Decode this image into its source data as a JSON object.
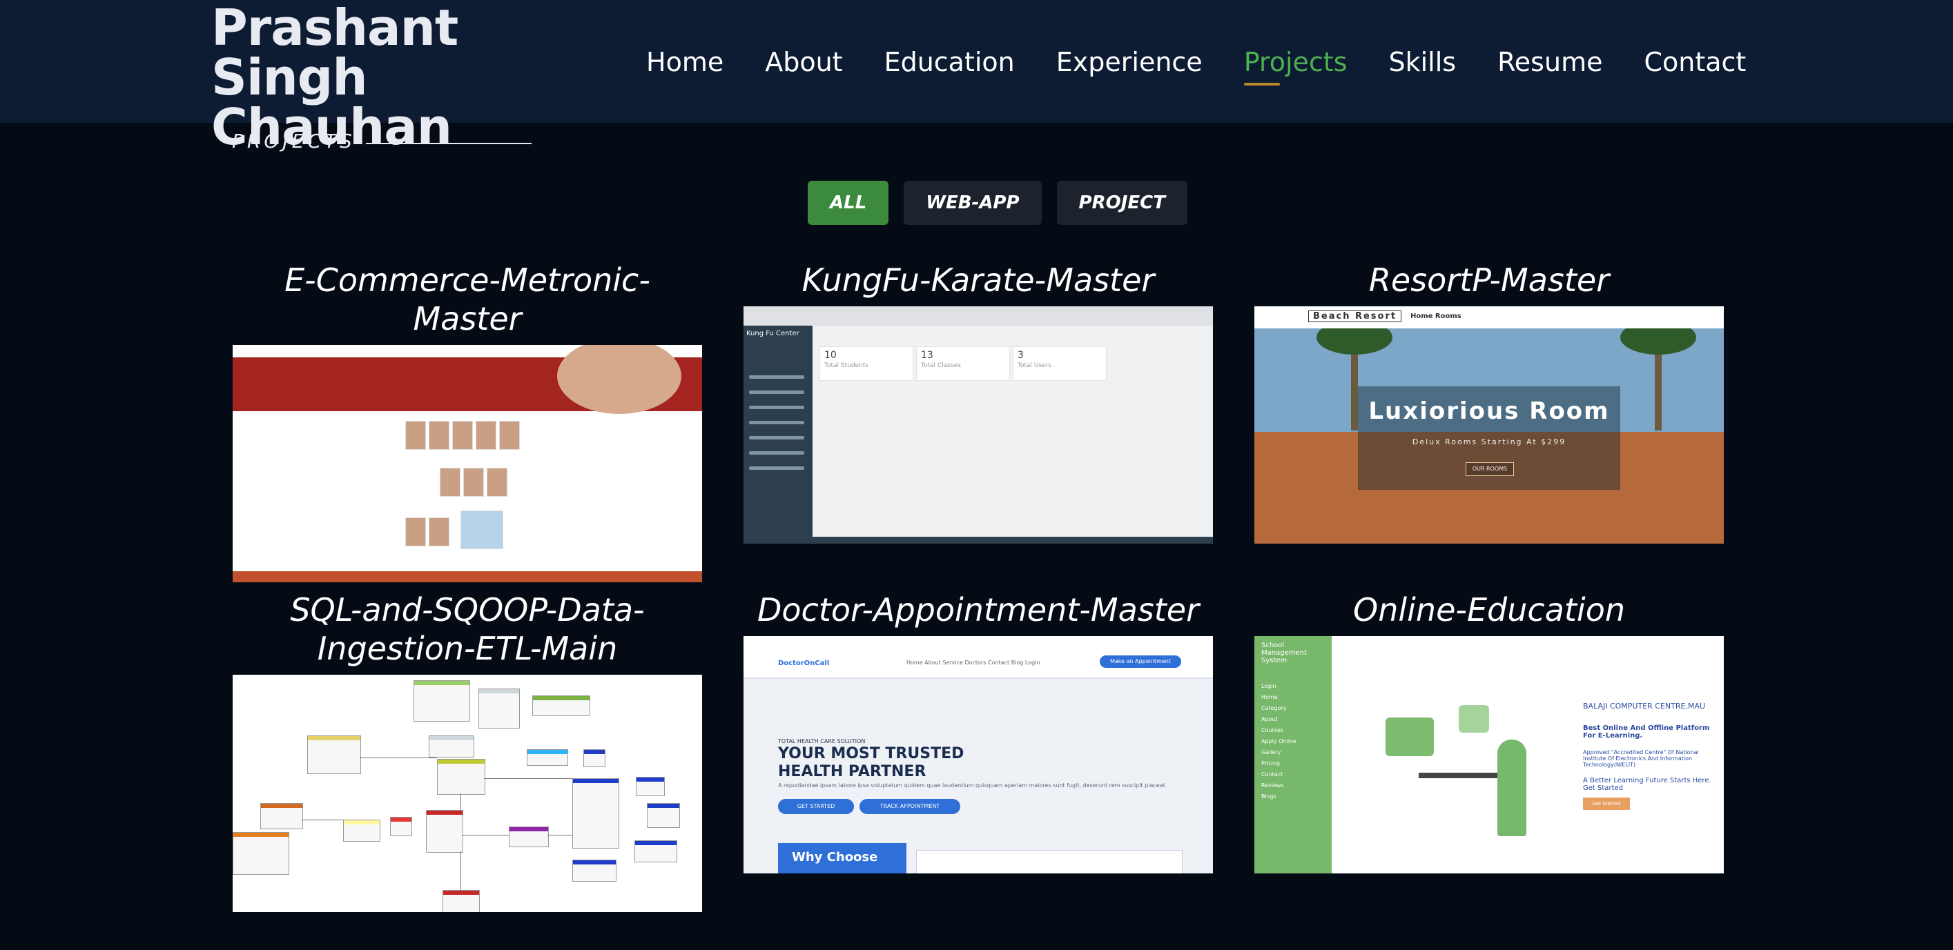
{
  "header": {
    "name_line1": "Prashant Singh",
    "name_line2": "Chauhan",
    "nav": [
      "Home",
      "About",
      "Education",
      "Experience",
      "Projects",
      "Skills",
      "Resume",
      "Contact"
    ],
    "active_nav": "Projects"
  },
  "section": {
    "title": "PROJECTS"
  },
  "filters": {
    "all": "ALL",
    "webapp": "WEB-APP",
    "project": "PROJECT",
    "active": "ALL"
  },
  "projects": [
    {
      "title": "E-Commerce-Metronic-Master"
    },
    {
      "title": "KungFu-Karate-Master"
    },
    {
      "title": "ResortP-Master"
    },
    {
      "title": "SQL-and-SQOOP-Data-Ingestion-ETL-Main"
    },
    {
      "title": "Doctor-Appointment-Master"
    },
    {
      "title": "Online-Education"
    }
  ],
  "thumbs": {
    "kungfu": {
      "app_name": "Kung Fu Center",
      "stats": [
        {
          "num": "10",
          "label": "Total Students"
        },
        {
          "num": "13",
          "label": "Total Classes"
        },
        {
          "num": "3",
          "label": "Total Users"
        }
      ]
    },
    "resort": {
      "logo": "Beach Resort",
      "links": "Home   Rooms",
      "headline": "Luxiorious Room",
      "sub": "Delux Rooms Starting At $299",
      "button": "OUR ROOMS"
    },
    "doctor": {
      "logo": "DoctorOnCall",
      "links": "Home   About   Service   Doctors   Contact   Blog   Login",
      "make_btn": "Make an Appointment",
      "kicker": "TOTAL HEALTH CARE SOLUTION",
      "headline_1": "YOUR MOST TRUSTED",
      "headline_2": "HEALTH PARTNER",
      "para": "A repudiandae ipsam labore ipsa voluptatum quidem quae laudantium quisquam aperiam maiores sunt fugit, deserunt rem suscipit placeat.",
      "btn_start": "GET STARTED",
      "btn_track": "TRACK APPOINTMENT",
      "why": "Why Choose"
    },
    "education": {
      "side_title": "School Management System",
      "side_links": [
        "Login",
        "Home",
        "Category",
        "About",
        "Courses",
        "Apply Online",
        "Gallery",
        "Pricing",
        "Contact",
        "Reviews",
        "Blogs"
      ],
      "heading": "BALAJI COMPUTER CENTRE,MAU",
      "line1": "Best Online And Offline Platform For E-Learning.",
      "line2": "Approved \"Accredited Centre\" Of National Institute Of Electronics And Information Technology(NIELIT)",
      "line3": "A Better Learning Future Starts Here. Get Started",
      "button": "Get Started"
    }
  }
}
